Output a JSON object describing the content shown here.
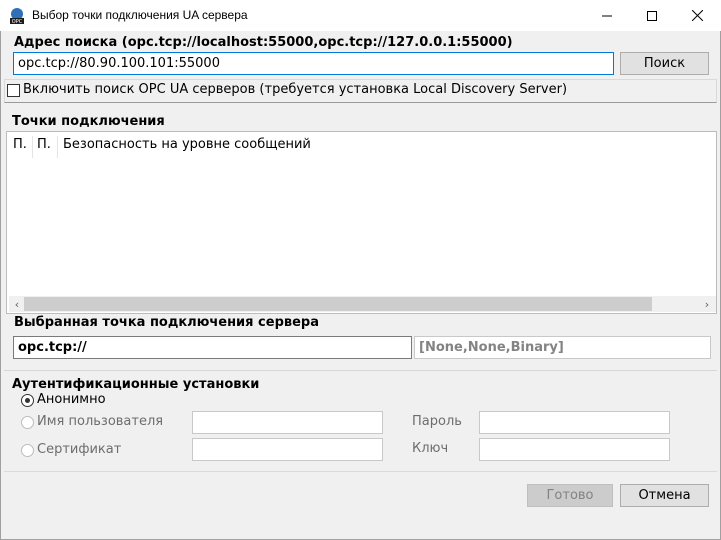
{
  "window": {
    "title": "Выбор точки подключения UA сервера",
    "controls": {
      "minimize": "—",
      "maximize": "☐",
      "close": "✕"
    }
  },
  "search": {
    "group_label": "Адрес поиска (opc.tcp://localhost:55000,opc.tcp://127.0.0.1:55000)",
    "url_value": "opc.tcp://80.90.100.101:55000",
    "search_button": "Поиск"
  },
  "discovery": {
    "checkbox_label": "Включить поиск OPC UA серверов (требуется установка Local Discovery Server)",
    "checked": false
  },
  "endpoints": {
    "group_label": "Точки подключения",
    "columns": [
      "П.",
      "П.",
      "Безопасность на уровне сообщений"
    ],
    "rows": []
  },
  "selected": {
    "group_label": "Выбранная точка подключения сервера",
    "url_value": "opc.tcp://",
    "security_value": "[None,None,Binary]"
  },
  "auth": {
    "group_label": "Аутентификационные установки",
    "anonymous_label": "Анонимно",
    "username_label": "Имя пользователя",
    "certificate_label": "Сертификат",
    "password_label": "Пароль",
    "key_label": "Ключ",
    "selected_option": "Анонимно"
  },
  "buttons": {
    "ok": "Готово",
    "cancel": "Отмена"
  },
  "colors": {
    "window_bg": "#f0f0f0",
    "focus_border": "#0078d7",
    "disabled_text": "#838383"
  }
}
